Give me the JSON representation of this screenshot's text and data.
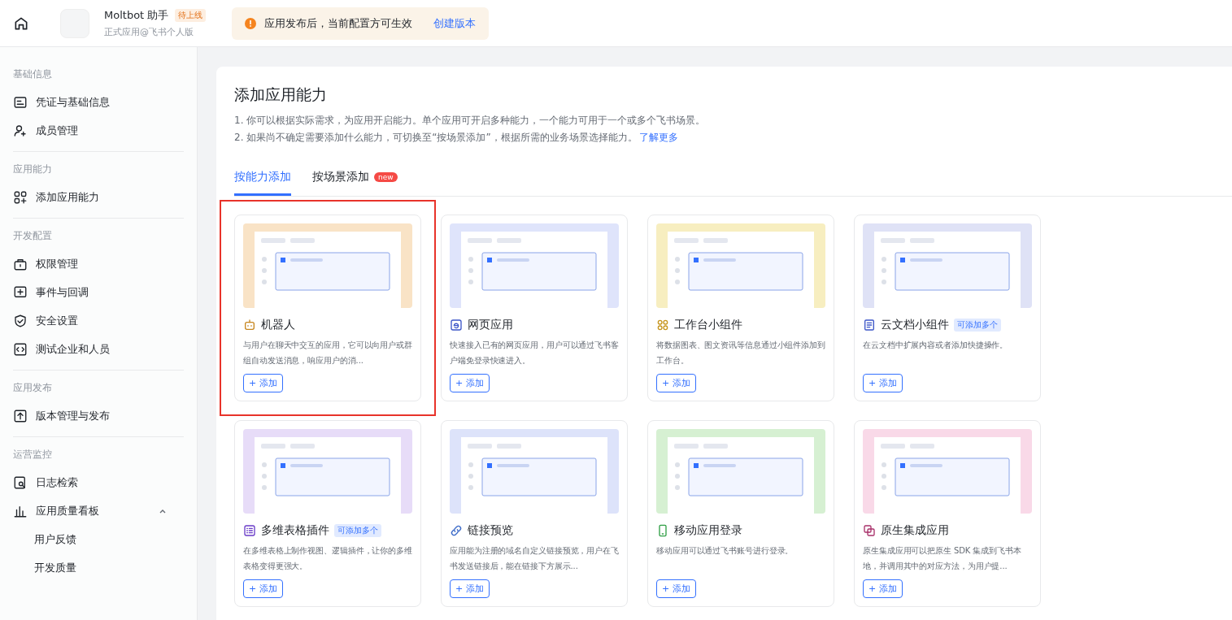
{
  "header": {
    "app_name": "Moltbot 助手",
    "status_badge": "待上线",
    "app_subtitle": "正式应用@飞书个人版",
    "notice": {
      "text": "应用发布后，当前配置方可生效",
      "link": "创建版本"
    }
  },
  "sidebar": {
    "sections": [
      {
        "title": "基础信息",
        "items": [
          {
            "label": "凭证与基础信息",
            "selected": false
          },
          {
            "label": "成员管理",
            "selected": false
          }
        ]
      },
      {
        "title": "应用能力",
        "items": [
          {
            "label": "添加应用能力",
            "selected": false
          }
        ]
      },
      {
        "title": "开发配置",
        "items": [
          {
            "label": "权限管理",
            "selected": false
          },
          {
            "label": "事件与回调",
            "selected": false
          },
          {
            "label": "安全设置",
            "selected": false
          },
          {
            "label": "测试企业和人员",
            "selected": false
          }
        ]
      },
      {
        "title": "应用发布",
        "items": [
          {
            "label": "版本管理与发布",
            "selected": false
          }
        ]
      },
      {
        "title": "运营监控",
        "items": [
          {
            "label": "日志检索",
            "selected": false
          },
          {
            "label": "应用质量看板",
            "selected": false,
            "expanded": true,
            "children": [
              {
                "label": "用户反馈",
                "selected": false
              },
              {
                "label": "开发质量",
                "selected": false
              }
            ]
          }
        ]
      }
    ]
  },
  "main": {
    "title": "添加应用能力",
    "notes": [
      "1. 你可以根据实际需求，为应用开启能力。单个应用可开启多种能力，一个能力可用于一个或多个飞书场景。",
      "2. 如果尚不确定需要添加什么能力，可切换至“按场景添加”，根据所需的业务场景选择能力。"
    ],
    "learn_more": "了解更多",
    "tabs": [
      {
        "label": "按能力添加",
        "selected": true
      },
      {
        "label": "按场景添加",
        "selected": false,
        "badge": "new"
      }
    ],
    "cards": [
      {
        "title": "机器人",
        "color": "#f9e3c6",
        "description": "与用户在聊天中交互的应用，它可以向用户或群组自动发送消息，响应用户的消...",
        "button": "+ 添加",
        "highlighted": true
      },
      {
        "title": "网页应用",
        "color": "#dfe4fb",
        "description": "快速接入已有的网页应用，用户可以通过飞书客户端免登录快速进入。",
        "button": "+ 添加"
      },
      {
        "title": "工作台小组件",
        "color": "#f7eec0",
        "description": "将数据图表、图文资讯等信息通过小组件添加到工作台。",
        "button": "+ 添加"
      },
      {
        "title": "云文档小组件",
        "color": "#dfe2f6",
        "badge": "可添加多个",
        "description": "在云文档中扩展内容或者添加快捷操作。",
        "button": "+ 添加"
      },
      {
        "title": "多维表格插件",
        "color": "#e7dcf8",
        "badge": "可添加多个",
        "description": "在多维表格上制作视图、逻辑插件，让你的多维表格变得更强大。",
        "button": "+ 添加"
      },
      {
        "title": "链接预览",
        "color": "#dde3fa",
        "description": "应用能为注册的域名自定义链接预览，用户在飞书发送链接后，能在链接下方展示...",
        "button": "+ 添加"
      },
      {
        "title": "移动应用登录",
        "color": "#d6f0d2",
        "description": "移动应用可以通过飞书账号进行登录。",
        "button": "+ 添加"
      },
      {
        "title": "原生集成应用",
        "color": "#f9d9e8",
        "description": "原生集成应用可以把原生 SDK 集成到飞书本地，并调用其中的对应方法，为用户提...",
        "button": "+ 添加"
      }
    ]
  }
}
